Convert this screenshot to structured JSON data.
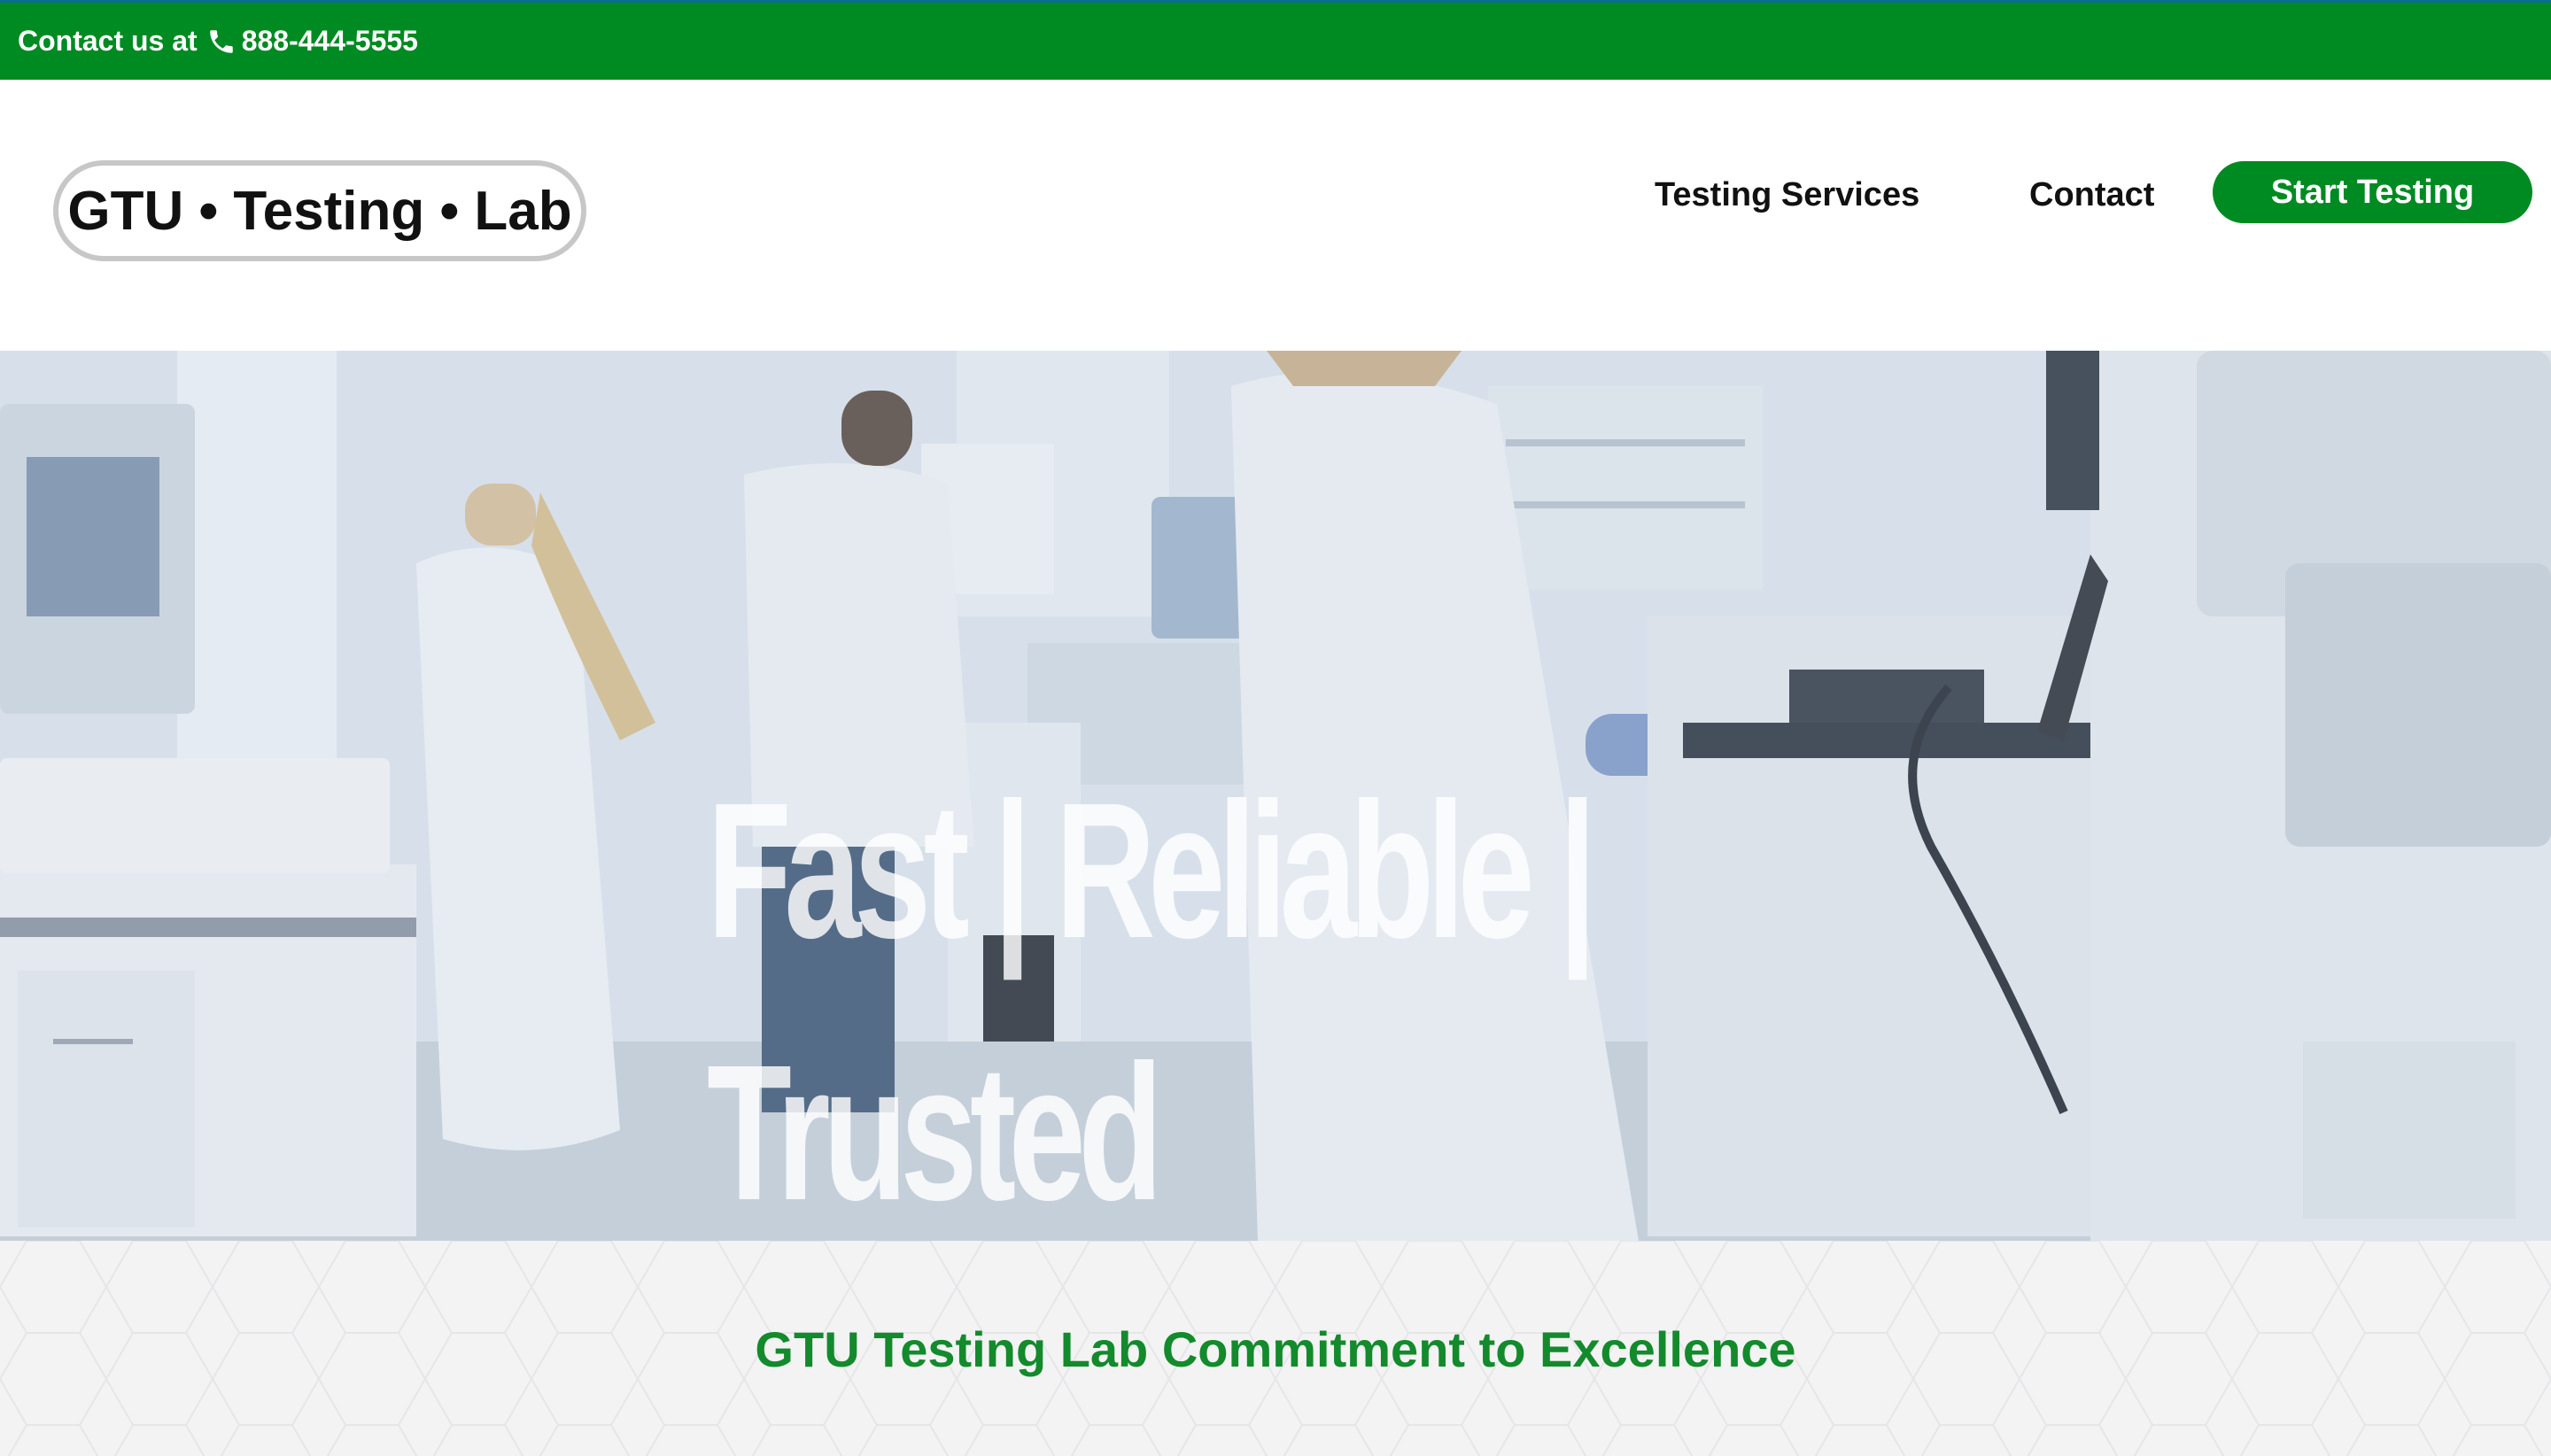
{
  "topbar": {
    "contact_prefix": "Contact us at",
    "phone": "888-444-5555",
    "icon": "phone-icon",
    "background_color": "#008a22"
  },
  "header": {
    "logo_text": "GTU • Testing • Lab",
    "nav": {
      "testing_services": "Testing Services",
      "contact": "Contact"
    },
    "cta_label": "Start Testing",
    "accent_color": "#008a22"
  },
  "hero": {
    "title": "Fast | Reliable | Trusted"
  },
  "commitment": {
    "title": "GTU Testing Lab Commitment to Excellence",
    "title_color": "#138a2c"
  }
}
